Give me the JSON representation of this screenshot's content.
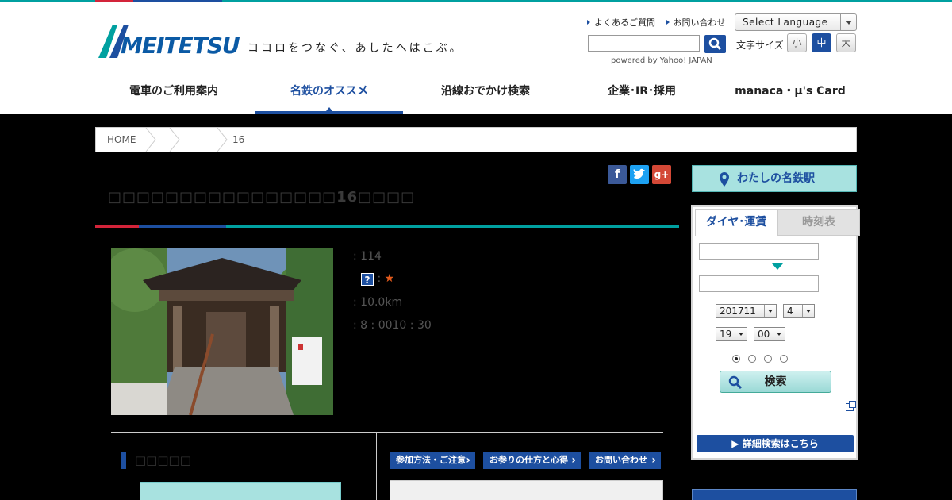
{
  "header": {
    "logo_text": "MEITETSU",
    "tagline": "ココロをつなぐ、あしたへはこぶ。",
    "util_links": [
      "よくあるご質問",
      "お問い合わせ"
    ],
    "language_select": "Select Language",
    "search_powered": "powered by Yahoo! JAPAN",
    "fontsize_label": "文字サイズ",
    "fontsize_small": "小",
    "fontsize_medium": "中",
    "fontsize_large": "大"
  },
  "nav": {
    "items": [
      "電車のご利用案内",
      "名鉄のオススメ",
      "沿線おでかけ検索",
      "企業･IR･採用",
      "manaca・μ's Card"
    ],
    "active_index": 1
  },
  "breadcrumb": {
    "home": "HOME",
    "current": "16"
  },
  "article": {
    "title": "□□□□□□□□□□□□□□□□16□□□□",
    "info": {
      "line1": ": 114",
      "help": "?",
      "line2_sep": ":",
      "star": "★",
      "distance": ": 10.0km",
      "hours": ": 8 : 0010 : 30"
    },
    "sub_heading": "□□□□□",
    "buttons": [
      "参加方法・ご注意",
      "お参りの仕方と心得",
      "お問い合わせ"
    ]
  },
  "sidebar": {
    "my_station": "わたしの名鉄駅",
    "tabs": [
      "ダイヤ･運賃",
      "時刻表"
    ],
    "year_month": "201711",
    "day": "4",
    "hour": "19",
    "minute": "00",
    "search_label": "検索",
    "detail_search": "▶ 詳細検索はこちら"
  },
  "colors": {
    "brand_blue": "#1d4fa0",
    "teal": "#00a0a0",
    "red": "#d3243a",
    "aqua": "#a8e2e0"
  }
}
